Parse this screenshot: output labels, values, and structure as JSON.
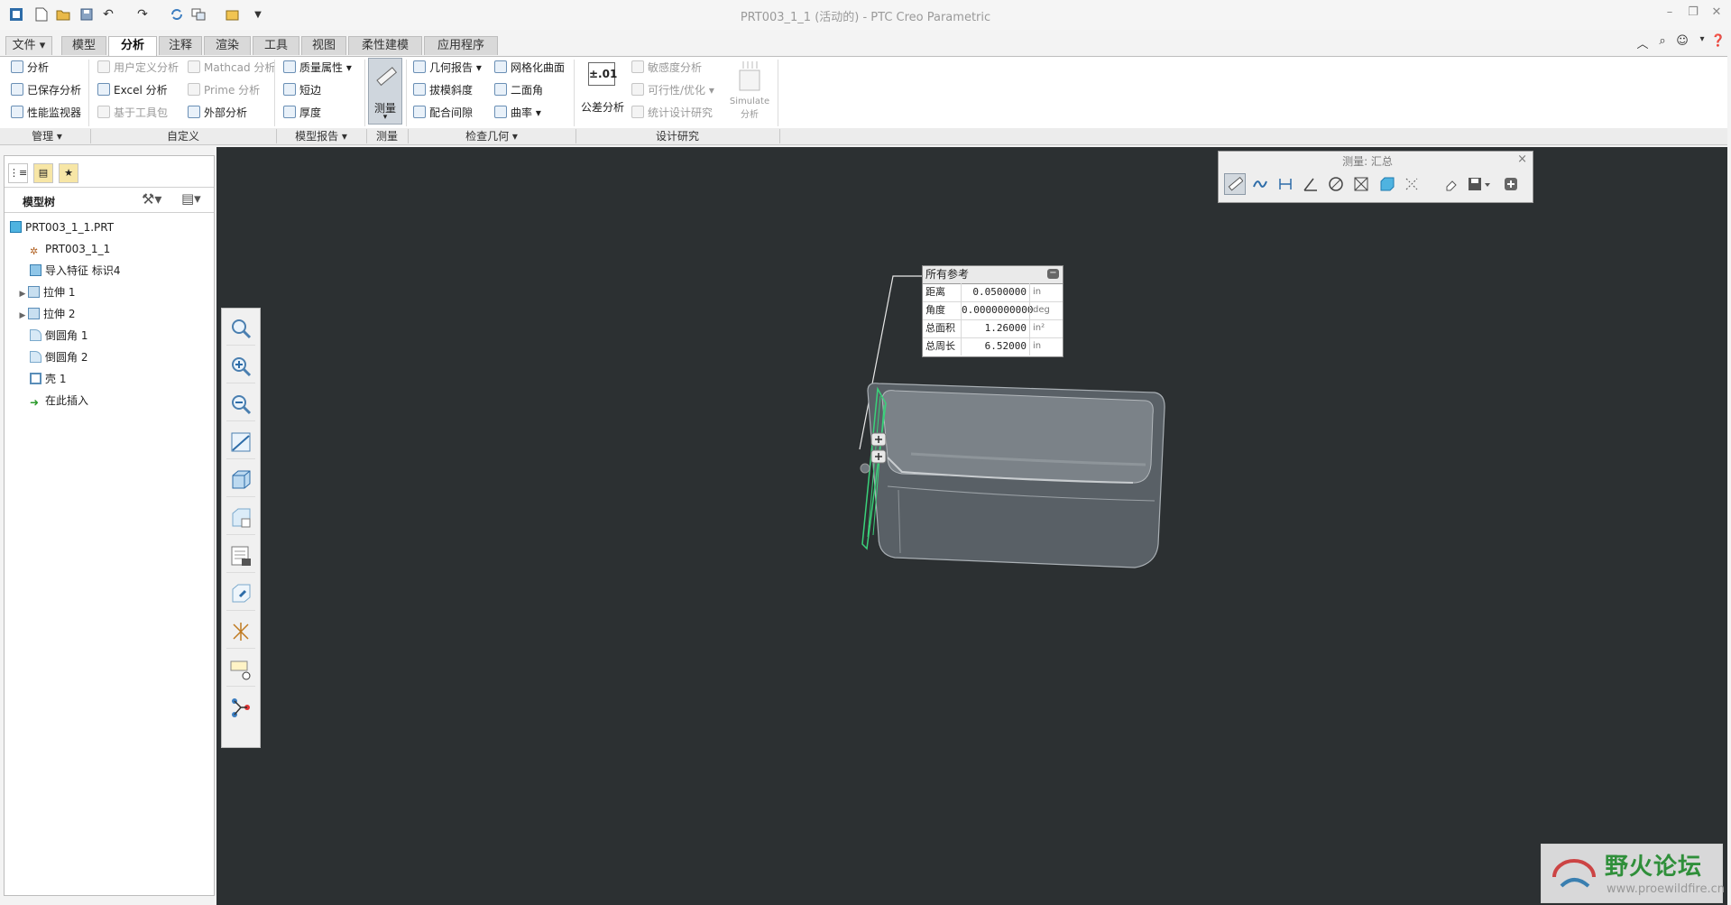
{
  "window": {
    "title": "PRT003_1_1 (活动的) - PTC Creo Parametric"
  },
  "tabs": [
    {
      "label": "文件"
    },
    {
      "label": "模型"
    },
    {
      "label": "分析"
    },
    {
      "label": "注释"
    },
    {
      "label": "渲染"
    },
    {
      "label": "工具"
    },
    {
      "label": "视图"
    },
    {
      "label": "柔性建模"
    },
    {
      "label": "应用程序"
    }
  ],
  "ribbon": {
    "manage": {
      "analysis": "分析",
      "saved_analysis": "已保存分析",
      "perf_monitor": "性能监视器"
    },
    "custom": {
      "user_defined": "用户定义分析",
      "mathcad": "Mathcad 分析",
      "excel": "Excel 分析",
      "prime": "Prime 分析",
      "toolkit": "基于工具包",
      "external": "外部分析"
    },
    "model_report": {
      "mass_props": "质量属性",
      "short_edge": "短边",
      "thickness": "厚度"
    },
    "measure": {
      "label": "测量"
    },
    "inspect_geometry": {
      "geom_report": "几何报告",
      "mesh_surface": "网格化曲面",
      "draft": "拔模斜度",
      "dihedral": "二面角",
      "clearance": "配合间隙",
      "curvature": "曲率"
    },
    "design_study": {
      "tolerance_icon": "±.01",
      "tolerance": "公差分析",
      "sensitivity": "敏感度分析",
      "feasibility": "可行性/优化",
      "stat_design": "统计设计研究",
      "simulate_line1": "Simulate",
      "simulate_line2": "分析"
    },
    "groups": [
      "管理",
      "自定义",
      "模型报告",
      "测量",
      "检查几何",
      "设计研究"
    ]
  },
  "model_tree": {
    "title": "模型树",
    "items": [
      {
        "label": "PRT003_1_1.PRT",
        "icon": "part-icon"
      },
      {
        "label": "PRT003_1_1",
        "icon": "csys-icon"
      },
      {
        "label": "导入特征 标识4",
        "icon": "import-feature-icon"
      },
      {
        "label": "拉伸 1",
        "icon": "extrude-icon"
      },
      {
        "label": "拉伸 2",
        "icon": "extrude-icon"
      },
      {
        "label": "倒圆角 1",
        "icon": "round-icon"
      },
      {
        "label": "倒圆角 2",
        "icon": "round-icon"
      },
      {
        "label": "壳 1",
        "icon": "shell-icon"
      },
      {
        "label": "在此插入",
        "icon": "insert-here-icon"
      }
    ]
  },
  "measure_toolbar": {
    "title": "测量: 汇总",
    "close": "×"
  },
  "result_panel": {
    "header": "所有参考",
    "rows": [
      {
        "label": "距离",
        "value": "0.0500000",
        "unit": "in"
      },
      {
        "label": "角度",
        "value": "0.0000000000",
        "unit": "deg"
      },
      {
        "label": "总面积",
        "value": "1.26000",
        "unit": "in²"
      },
      {
        "label": "总周长",
        "value": "6.52000",
        "unit": "in"
      }
    ]
  },
  "watermark": {
    "text": "野火论坛",
    "url": "www.proewildfire.cn"
  },
  "colors": {
    "viewport": "#2c3032",
    "selection": "#3ad17a",
    "model": "#6f767c"
  }
}
